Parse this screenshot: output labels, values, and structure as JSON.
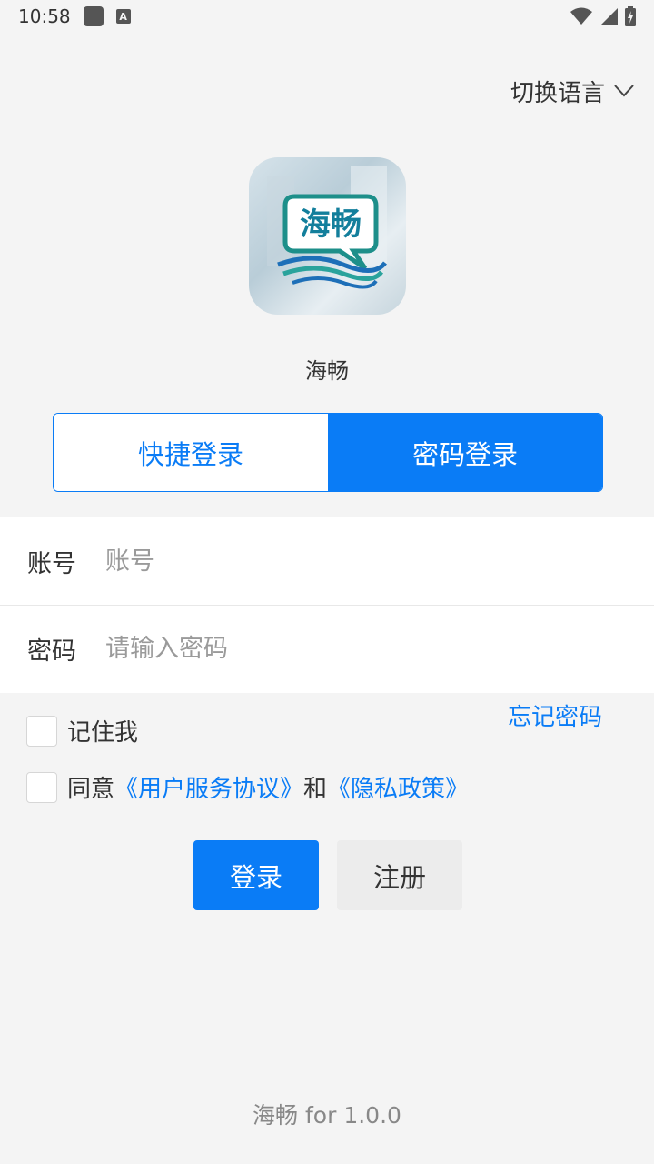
{
  "status": {
    "time": "10:58"
  },
  "header": {
    "language_switch": "切换语言"
  },
  "app": {
    "name": "海畅",
    "logo_text": "海畅",
    "version": "海畅 for 1.0.0"
  },
  "tabs": {
    "quick": "快捷登录",
    "password": "密码登录"
  },
  "form": {
    "account_label": "账号",
    "account_placeholder": "账号",
    "password_label": "密码",
    "password_placeholder": "请输入密码"
  },
  "options": {
    "forgot": "忘记密码",
    "remember": "记住我",
    "agree_prefix": "同意",
    "user_agreement": "《用户服务协议》",
    "and": "和",
    "privacy_policy": "《隐私政策》"
  },
  "buttons": {
    "login": "登录",
    "register": "注册"
  },
  "colors": {
    "accent": "#0a7cf6",
    "background": "#f4f4f4"
  }
}
